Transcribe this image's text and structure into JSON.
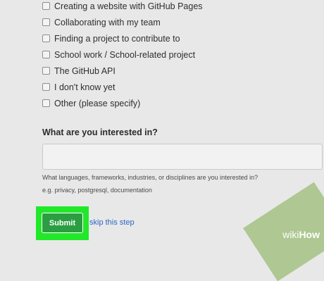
{
  "options": [
    "Creating a website with GitHub Pages",
    "Collaborating with my team",
    "Finding a project to contribute to",
    "School work / School-related project",
    "The GitHub API",
    "I don't know yet",
    "Other (please specify)"
  ],
  "interests": {
    "question": "What are you interested in?",
    "value": "",
    "hint": "What languages, frameworks, industries, or disciplines are you interested in?",
    "examples": "e.g. privacy, postgresql, documentation"
  },
  "actions": {
    "submit_label": "Submit",
    "skip_label": "skip this step"
  },
  "watermark": {
    "part1": "wiki",
    "part2": "How"
  },
  "colors": {
    "highlight": "#22e82a",
    "submit": "#2c9e42",
    "link": "#2b66c5"
  }
}
